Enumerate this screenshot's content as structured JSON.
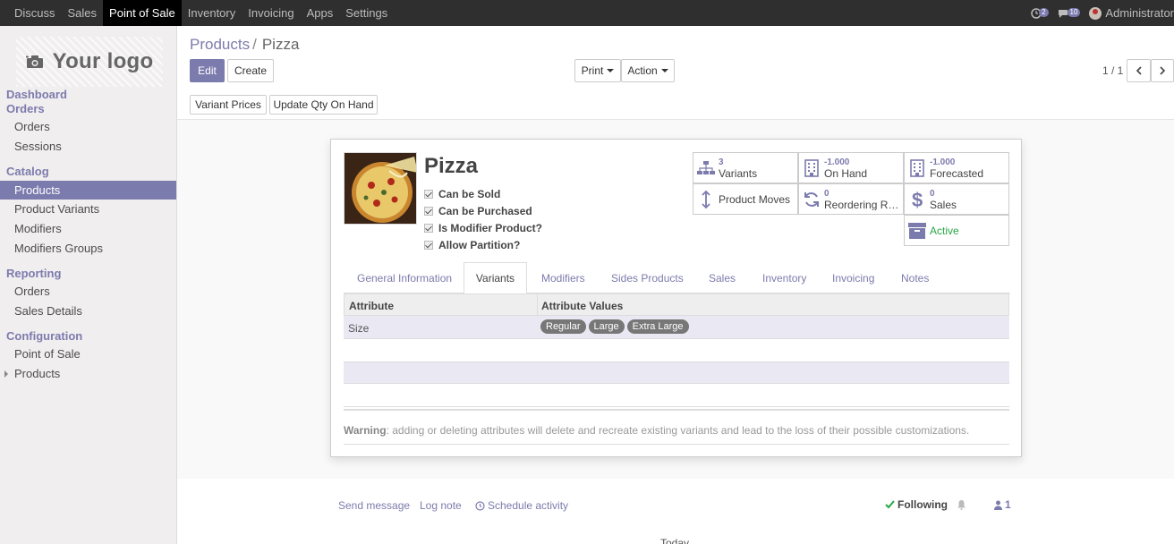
{
  "topbar": {
    "menu": [
      "Discuss",
      "Sales",
      "Point of Sale",
      "Inventory",
      "Invoicing",
      "Apps",
      "Settings"
    ],
    "active_index": 2,
    "chat_count": "2",
    "activity_count": "10",
    "user_name": "Administrator"
  },
  "sidebar": {
    "logo_text": "Your logo",
    "sections": {
      "dashboard": "Dashboard",
      "orders": "Orders",
      "catalog": "Catalog",
      "reporting": "Reporting",
      "configuration": "Configuration"
    },
    "items": {
      "orders": "Orders",
      "sessions": "Sessions",
      "products": "Products",
      "product_variants": "Product Variants",
      "modifiers": "Modifiers",
      "modifiers_groups": "Modifiers Groups",
      "rep_orders": "Orders",
      "sales_details": "Sales Details",
      "point_of_sale": "Point of Sale",
      "cfg_products": "Products"
    }
  },
  "breadcrumb": {
    "parent": "Products",
    "separator": "/",
    "current": "Pizza"
  },
  "buttons": {
    "edit": "Edit",
    "create": "Create",
    "print": "Print",
    "action": "Action",
    "variant_prices": "Variant Prices",
    "update_qty": "Update Qty On Hand"
  },
  "pager": {
    "value": "1 / 1"
  },
  "product": {
    "name": "Pizza",
    "checks": [
      "Can be Sold",
      "Can be Purchased",
      "Is Modifier Product?",
      "Allow Partition?"
    ]
  },
  "stats": {
    "variants": {
      "value": "3",
      "label": "Variants"
    },
    "on_hand": {
      "value": "-1.000",
      "label": "On Hand"
    },
    "forecasted": {
      "value": "-1.000",
      "label": "Forecasted"
    },
    "moves": {
      "label": "Product Moves"
    },
    "reordering": {
      "value": "0",
      "label": "Reordering Rules"
    },
    "sales": {
      "value": "0",
      "label": "Sales"
    },
    "active": {
      "label": "Active"
    }
  },
  "tabs": [
    "General Information",
    "Variants",
    "Modifiers",
    "Sides Products",
    "Sales",
    "Inventory",
    "Invoicing",
    "Notes"
  ],
  "active_tab": 1,
  "table": {
    "headers": [
      "Attribute",
      "Attribute Values"
    ],
    "row": {
      "attribute": "Size",
      "values": [
        "Regular",
        "Large",
        "Extra Large"
      ]
    }
  },
  "warning": {
    "label": "Warning",
    "text": ": adding or deleting attributes will delete and recreate existing variants and lead to the loss of their possible customizations."
  },
  "chatter": {
    "send_message": "Send message",
    "log_note": "Log note",
    "schedule_activity": "Schedule activity",
    "following": "Following",
    "followers": "1",
    "today": "Today"
  },
  "colors": {
    "accent": "#7c7bad",
    "topbar": "#2f2f2f",
    "active_green": "#28a745"
  }
}
